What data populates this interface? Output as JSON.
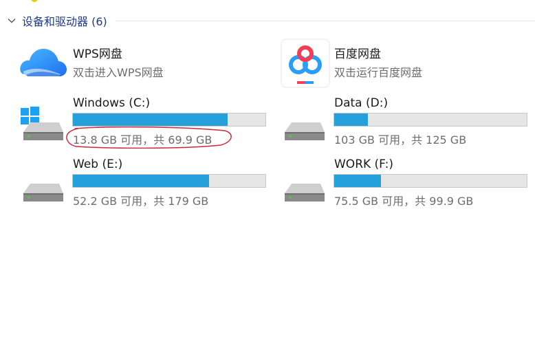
{
  "group": {
    "title": "设备和驱动器 (6)"
  },
  "apps": [
    {
      "name": "WPS网盘",
      "sub": "双击进入WPS网盘"
    },
    {
      "name": "百度网盘",
      "sub": "双击运行百度网盘"
    }
  ],
  "drives": [
    {
      "name": "Windows (C:)",
      "space": "13.8 GB 可用，共 69.9 GB",
      "used_fraction": 0.803
    },
    {
      "name": "Data (D:)",
      "space": "103 GB 可用，共 125 GB",
      "used_fraction": 0.176
    },
    {
      "name": "Web (E:)",
      "space": "52.2 GB 可用，共 179 GB",
      "used_fraction": 0.708
    },
    {
      "name": "WORK (F:)",
      "space": "75.5 GB 可用，共 99.9 GB",
      "used_fraction": 0.244
    }
  ],
  "colors": {
    "accent_text": "#1e3a8a",
    "bar_fill": "#26a0da",
    "bar_track": "#e6e6e6",
    "annotation": "#d0263a"
  },
  "icons": {
    "wps": "wps-cloud-icon",
    "baidu": "baidu-netdisk-icon",
    "drive": "hard-drive-icon",
    "windows": "windows-logo-icon",
    "chevron": "chevron-down-icon"
  }
}
